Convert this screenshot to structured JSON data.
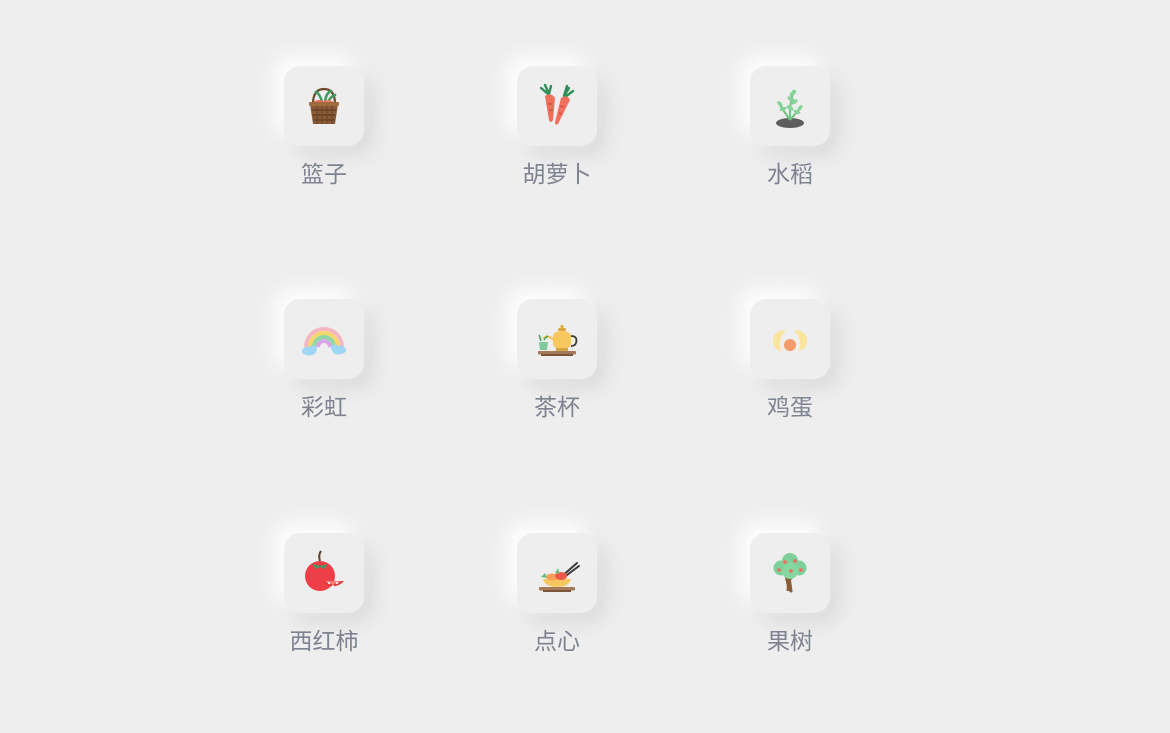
{
  "items": [
    {
      "label": "篮子",
      "icon": "basket-icon"
    },
    {
      "label": "胡萝卜",
      "icon": "carrot-icon"
    },
    {
      "label": "水稻",
      "icon": "rice-plant-icon"
    },
    {
      "label": "彩虹",
      "icon": "rainbow-icon"
    },
    {
      "label": "茶杯",
      "icon": "teapot-icon"
    },
    {
      "label": "鸡蛋",
      "icon": "egg-icon"
    },
    {
      "label": "西红柿",
      "icon": "tomato-icon"
    },
    {
      "label": "点心",
      "icon": "dim-sum-icon"
    },
    {
      "label": "果树",
      "icon": "fruit-tree-icon"
    }
  ],
  "colors": {
    "background": "#eeeeee",
    "label": "#7d8390"
  }
}
